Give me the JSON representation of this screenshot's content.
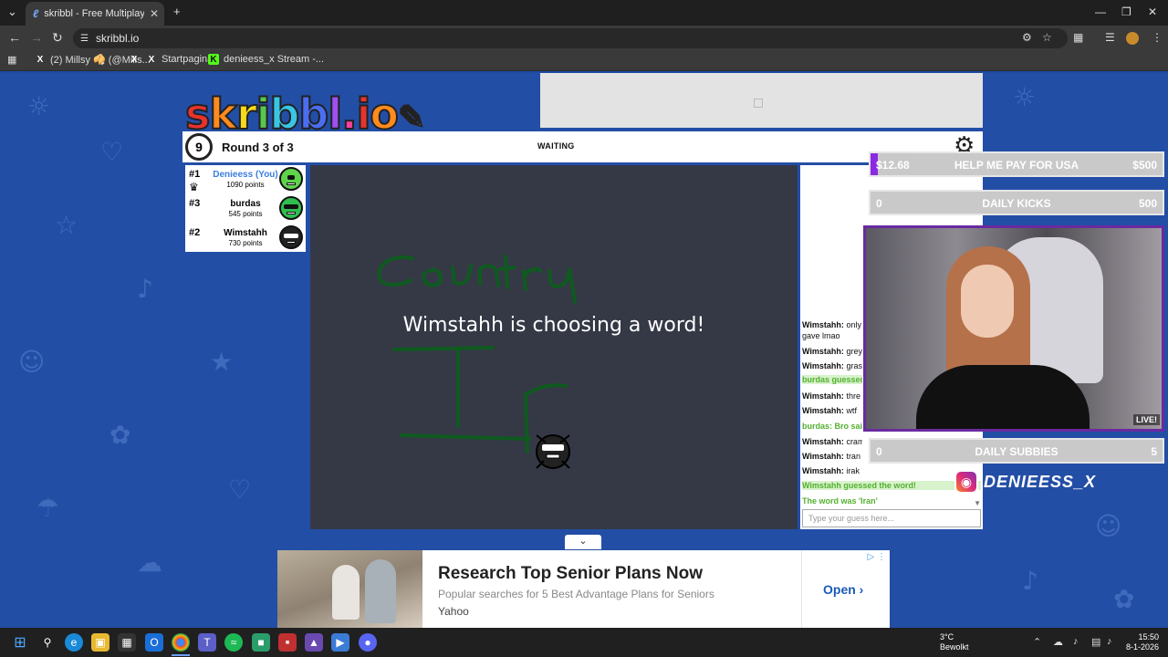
{
  "browser": {
    "tab_title": "skribbl - Free Multiplayer Draw...",
    "tab_favicon": "ℓ",
    "url": "skribbl.io",
    "bookmarks": [
      {
        "label": "(2) Millsy 🥠 (@Mills...",
        "icon": "x-icon"
      },
      {
        "label": "Startpagina",
        "icon": "x-icon"
      },
      {
        "label": "denieess_x Stream -...",
        "icon": "kick-icon"
      }
    ]
  },
  "game": {
    "logo": "skribbl.io",
    "logo_letters": [
      "s",
      "k",
      "r",
      "i",
      "b",
      "b",
      "l",
      ".",
      "i",
      "o"
    ],
    "logo_colors": [
      "#e8332d",
      "#ff8a1d",
      "#f7d91c",
      "#58c84b",
      "#39c5e4",
      "#4a6df2",
      "#a14ff2",
      "#ff3fa0",
      "#e8332d",
      "#ff8a1d"
    ],
    "timer": "9",
    "round": "Round 3 of 3",
    "status": "WAITING",
    "players": [
      {
        "rank": "#1",
        "name": "Denieess (You)",
        "points": "1090 points",
        "face_color": "#5ed44a",
        "is_you": true
      },
      {
        "rank": "#3",
        "name": "burdas",
        "points": "545 points",
        "face_color": "#2fbf4e",
        "is_you": false
      },
      {
        "rank": "#2",
        "name": "Wimstahh",
        "points": "730 points",
        "face_color": "#222222",
        "is_you": false
      }
    ],
    "canvas_message": "Wimstahh is choosing a word!",
    "chat": [
      {
        "name": "Wimstahh:",
        "text": "only",
        "style": "normal"
      },
      {
        "name": "",
        "text": "gave lmao",
        "style": "normal"
      },
      {
        "name": "Wimstahh:",
        "text": "grey",
        "style": "normal"
      },
      {
        "name": "Wimstahh:",
        "text": "gras",
        "style": "normal"
      },
      {
        "name": "",
        "text": "burdas guessed",
        "style": "green-bg"
      },
      {
        "name": "Wimstahh:",
        "text": "thre",
        "style": "normal"
      },
      {
        "name": "Wimstahh:",
        "text": "wtf",
        "style": "normal"
      },
      {
        "name": "burdas:",
        "text": "Bro said",
        "style": "green"
      },
      {
        "name": "Wimstahh:",
        "text": "cramp",
        "style": "normal"
      },
      {
        "name": "Wimstahh:",
        "text": "tran",
        "style": "normal"
      },
      {
        "name": "Wimstahh:",
        "text": "irak",
        "style": "normal"
      },
      {
        "name": "",
        "text": "Wimstahh guessed the word!",
        "style": "green-bg"
      },
      {
        "name": "",
        "text": "The word was 'Iran'",
        "style": "green"
      }
    ],
    "chat_placeholder": "Type your guess here..."
  },
  "stream": {
    "goals": [
      {
        "left": "$12.68",
        "label": "HELP ME PAY FOR USA",
        "right": "$500",
        "progress": 0.025
      },
      {
        "left": "0",
        "label": "DAILY KICKS",
        "right": "500",
        "progress": 0
      },
      {
        "left": "0",
        "label": "DAILY SUBBIES",
        "right": "5",
        "progress": 0
      }
    ],
    "live_badge": "LIVE!",
    "instagram_handle": "DENIEESS_X"
  },
  "ad": {
    "title": "Research Top Senior Plans Now",
    "subtitle": "Popular searches for 5 Best Advantage Plans for Seniors",
    "source": "Yahoo",
    "cta": "Open"
  },
  "taskbar": {
    "weather_temp": "3°C",
    "weather_desc": "Bewolkt",
    "time": "15:50",
    "date": "8-1-2026"
  },
  "colors": {
    "page_bg": "#234ea6",
    "canvas_bg": "#353946",
    "accent_purple": "#8a2be2",
    "chat_green": "#53b030"
  }
}
